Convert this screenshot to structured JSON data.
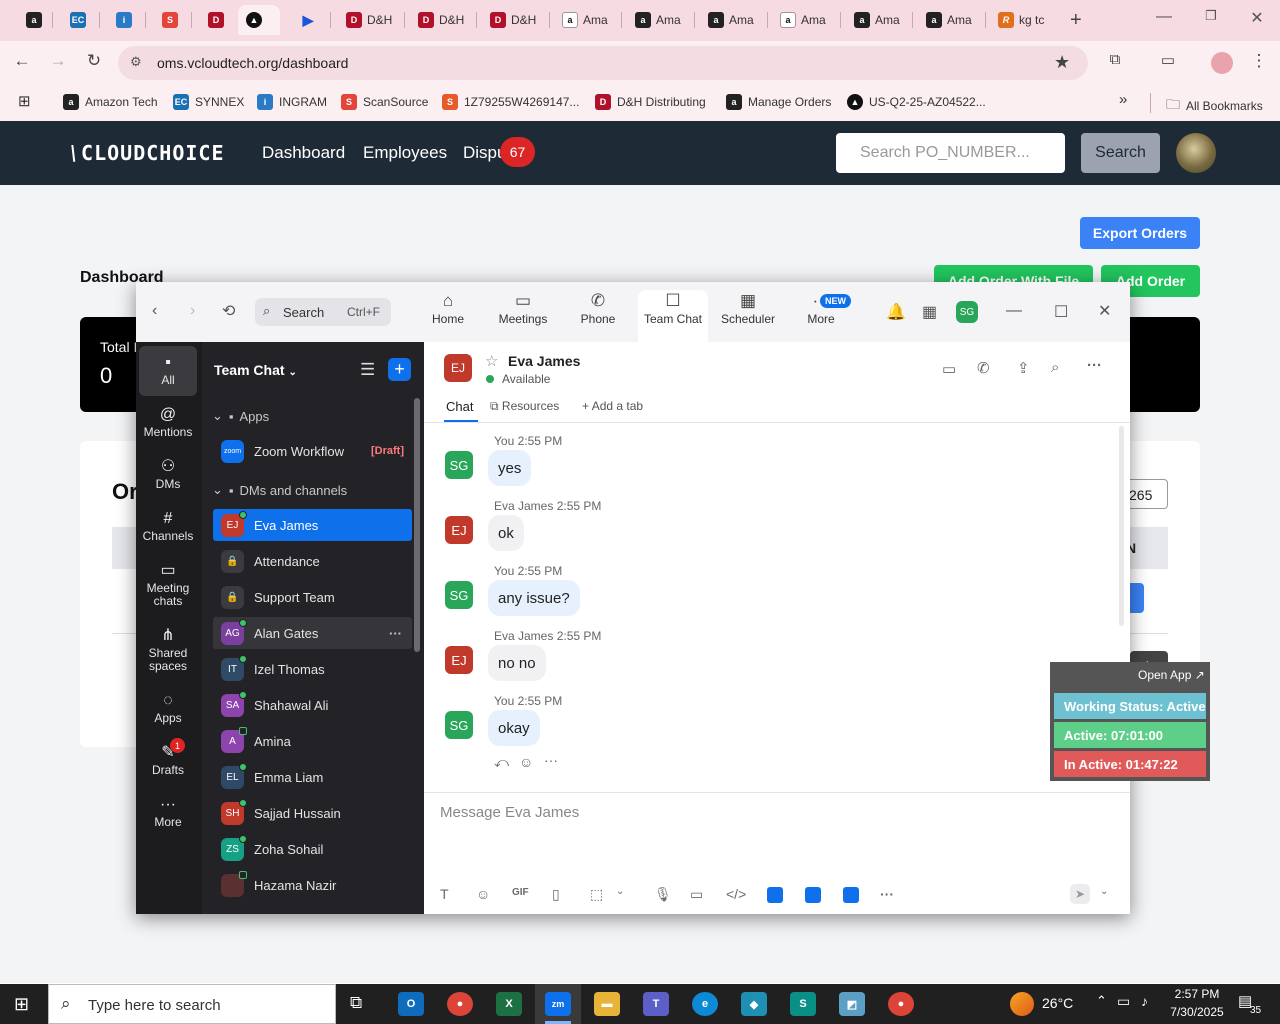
{
  "browser": {
    "tabs": [
      {
        "label": "",
        "icon": "amazon-icon"
      },
      {
        "label": "",
        "icon": "ec-icon"
      },
      {
        "label": "",
        "icon": "ingram-icon"
      },
      {
        "label": "",
        "icon": "scansource-icon"
      },
      {
        "label": "",
        "icon": "dh-icon"
      },
      {
        "label": "",
        "icon": "active-tab-icon"
      },
      {
        "label": "",
        "icon": "arrow-icon"
      },
      {
        "label": "D&H",
        "icon": "dh-icon"
      },
      {
        "label": "D&H",
        "icon": "dh-icon"
      },
      {
        "label": "D&H",
        "icon": "dh-icon"
      },
      {
        "label": "Ama",
        "icon": "amazon-icon"
      },
      {
        "label": "Ama",
        "icon": "amazon-icon"
      },
      {
        "label": "Ama",
        "icon": "amazon-icon"
      },
      {
        "label": "Ama",
        "icon": "amazon-icon"
      },
      {
        "label": "Ama",
        "icon": "amazon-icon"
      },
      {
        "label": "Ama",
        "icon": "amazon-icon"
      },
      {
        "label": "kg tc",
        "icon": "r-icon"
      }
    ],
    "new_tab": "+",
    "url": "oms.vcloudtech.org/dashboard",
    "bookmarks": [
      "Amazon Tech",
      "SYNNEX",
      "INGRAM",
      "ScanSource",
      "1Z79255W4269147...",
      "D&H Distributing",
      "Manage Orders",
      "US-Q2-25-AZ04522..."
    ],
    "bookmarks_more": "»",
    "all_bookmarks": "All Bookmarks"
  },
  "site": {
    "logo": "CLOUDCHOICE",
    "nav": [
      "Dashboard",
      "Employees",
      "Dispu"
    ],
    "disputes_badge": "67",
    "search_placeholder": "Search PO_NUMBER...",
    "search_button": "Search",
    "export_button": "Export Orders",
    "page_title": "Dashboard",
    "add_order_file_button": "Add Order With File",
    "add_order_button": "Add Order",
    "total_label": "Total I",
    "total_value": "0",
    "orders_heading": "Or",
    "field_value": "265",
    "col_label": "N",
    "partial_btn": "est"
  },
  "zoom": {
    "search_label": "Search",
    "search_shortcut": "Ctrl+F",
    "tabs": [
      "Home",
      "Meetings",
      "Phone",
      "Team Chat",
      "Scheduler",
      "More"
    ],
    "more_badge": "NEW",
    "user_initials": "SG",
    "rail": [
      "All",
      "Mentions",
      "DMs",
      "Channels",
      "Meeting chats",
      "Shared spaces",
      "Apps",
      "Drafts",
      "More"
    ],
    "drafts_badge": "1",
    "panel_title": "Team Chat",
    "apps_section": "Apps",
    "zoom_workflow": "Zoom Workflow",
    "draft_tag": "[Draft]",
    "dms_section": "DMs and channels",
    "contacts": [
      {
        "name": "Eva James",
        "initials": "EJ",
        "color": "#c0392b"
      },
      {
        "name": "Attendance",
        "initials": "",
        "color": "#3a3a3f"
      },
      {
        "name": "Support Team",
        "initials": "",
        "color": "#3a3a3f"
      },
      {
        "name": "Alan Gates",
        "initials": "AG",
        "color": "#7b3fa0"
      },
      {
        "name": "Izel Thomas",
        "initials": "IT",
        "color": "#2e4a66"
      },
      {
        "name": "Shahawal Ali",
        "initials": "SA",
        "color": "#8e44ad"
      },
      {
        "name": "Amina",
        "initials": "A",
        "color": "#8e44ad"
      },
      {
        "name": "Emma Liam",
        "initials": "EL",
        "color": "#2e4a66"
      },
      {
        "name": "Sajjad Hussain",
        "initials": "SH",
        "color": "#c0392b"
      },
      {
        "name": "Zoha Sohail",
        "initials": "ZS",
        "color": "#16a085"
      },
      {
        "name": "Hazama Nazir",
        "initials": "",
        "color": "#5a3030"
      }
    ],
    "chat": {
      "name": "Eva James",
      "initials": "EJ",
      "status": "Available",
      "tabs": [
        "Chat",
        "Resources",
        "Add a tab"
      ],
      "messages": [
        {
          "meta": "You 2:55 PM",
          "text": "yes",
          "initials": "SG",
          "me": true
        },
        {
          "meta": "Eva James 2:55 PM",
          "text": "ok",
          "initials": "EJ",
          "me": false
        },
        {
          "meta": "You 2:55 PM",
          "text": "any issue?",
          "initials": "SG",
          "me": true
        },
        {
          "meta": "Eva James 2:55 PM",
          "text": "no no",
          "initials": "EJ",
          "me": false
        },
        {
          "meta": "You 2:55 PM",
          "text": "okay",
          "initials": "SG",
          "me": true
        }
      ],
      "composer_placeholder": "Message Eva James"
    }
  },
  "tracker": {
    "open_app": "Open App ↗",
    "status": "Working Status: Active",
    "active": "Active: 07:01:00",
    "inactive": "In Active: 01:47:22"
  },
  "taskbar": {
    "search_placeholder": "Type here to search",
    "weather": "26°C",
    "time": "2:57 PM",
    "date": "7/30/2025",
    "notifications": "35"
  },
  "colors": {
    "accent": "#0e71eb",
    "site_nav": "#1f2a37",
    "export": "#3b82f6",
    "add": "#22c55e",
    "active_row": "#5ecf89",
    "inactive_row": "#e05a5a",
    "status_row": "#6ec1d0"
  }
}
